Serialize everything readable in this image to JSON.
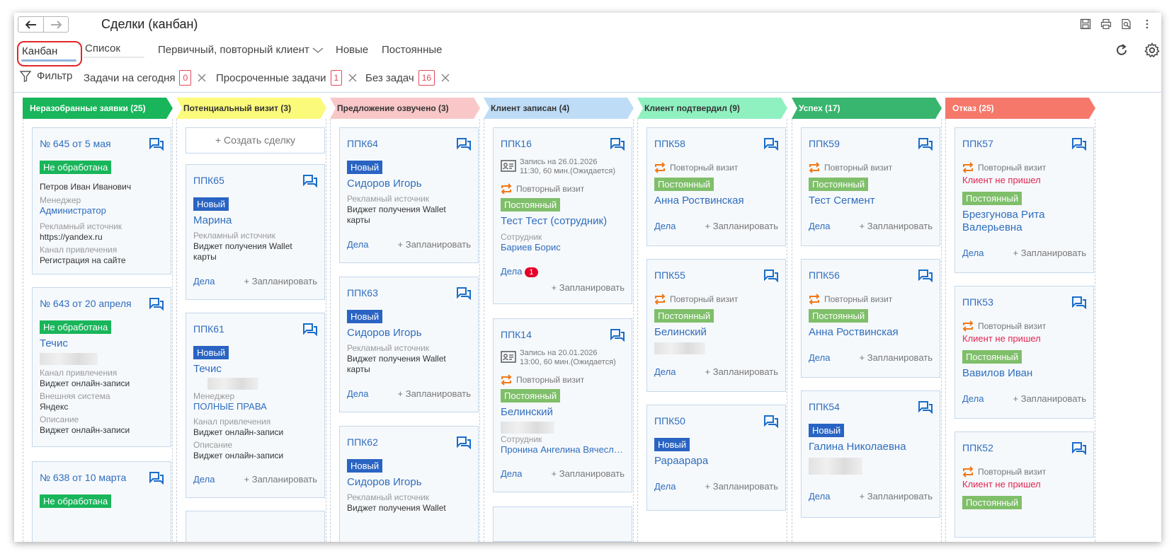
{
  "window": {
    "title": "Сделки (канбан)"
  },
  "tabs": {
    "kanban": "Канбан",
    "list": "Список"
  },
  "filters": {
    "client_type": "Первичный, повторный клиент",
    "new": "Новые",
    "permanent": "Постоянные",
    "filter_label": "Фильтр",
    "today_tasks": "Задачи на сегодня",
    "today_count": "0",
    "overdue": "Просроченные задачи",
    "overdue_count": "1",
    "no_tasks": "Без задач",
    "no_tasks_count": "16"
  },
  "common": {
    "deals": "Дела",
    "plan": "+ Запланировать",
    "create": "+ Создать сделку",
    "repeat": "Повторный визит",
    "no_show": "Клиент не пришел",
    "ad_source": "Рекламный источник",
    "channel": "Канал привлечения",
    "manager": "Менеджер",
    "external": "Внешняя система",
    "description": "Описание",
    "employee": "Сотрудник"
  },
  "columns": [
    {
      "title": "Неразобранные заявки (25)",
      "color": "#18b55a",
      "text_color": "#ffffff"
    },
    {
      "title": "Потенциальный визит (3)",
      "color": "#fbfa7a",
      "text_color": "#333333"
    },
    {
      "title": "Предложение озвучено (3)",
      "color": "#f9c7c8",
      "text_color": "#333333"
    },
    {
      "title": "Клиент записан (4)",
      "color": "#bfdcf7",
      "text_color": "#333333"
    },
    {
      "title": "Клиент подтвердил (9)",
      "color": "#8ff0c0",
      "text_color": "#333333"
    },
    {
      "title": "Успех (17)",
      "color": "#38b56e",
      "text_color": "#ffffff"
    },
    {
      "title": "Отказ (25)",
      "color": "#f5786b",
      "text_color": "#ffffff"
    }
  ],
  "col1": {
    "c1": {
      "num": "№ 645 от 5 мая",
      "badge": "Не обработана",
      "person": "Петров Иван Иванович",
      "manager": "Администратор",
      "source": "https://yandex.ru",
      "channel": "Регистрация на сайте"
    },
    "c2": {
      "num": "№ 643 от 20 апреля",
      "badge": "Не обработана",
      "name": "Течис",
      "channel": "Виджет онлайн-записи",
      "external": "Яндекс",
      "description": "Виджет онлайн-записи"
    },
    "c3": {
      "num": "№ 638 от 10 марта",
      "badge": "Не обработана"
    }
  },
  "col2": {
    "c1": {
      "num": "ППК65",
      "badge": "Новый",
      "name": "Марина",
      "source": "Виджет получения Wallet карты"
    },
    "c2": {
      "num": "ППК61",
      "badge": "Новый",
      "name": "Течис",
      "manager": "ПОЛНЫЕ ПРАВА",
      "channel": "Виджет онлайн-записи",
      "description": "Виджет онлайн-записи"
    }
  },
  "col3": {
    "c1": {
      "num": "ППК64",
      "badge": "Новый",
      "name": "Сидоров Игорь",
      "source": "Виджет получения Wallet карты"
    },
    "c2": {
      "num": "ППК63",
      "badge": "Новый",
      "name": "Сидоров Игорь",
      "source": "Виджет получения Wallet карты"
    },
    "c3": {
      "num": "ППК62",
      "badge": "Новый",
      "name": "Сидоров Игорь",
      "source": "Виджет получения Wallet"
    }
  },
  "col4": {
    "c1": {
      "num": "ППК16",
      "record1": "Запись на 26.01.2026",
      "record2": "11:30, 60 мин.(Ожидается)",
      "badge": "Постоянный",
      "name": "Тест Тест (сотрудник)",
      "employee": "Бариев Борис",
      "deals_count": "1"
    },
    "c2": {
      "num": "ППК14",
      "record1": "Запись на 20.01.2026",
      "record2": "13:00, 60 мин.(Ожидается)",
      "badge": "Постоянный",
      "name": "Белинский",
      "employee": "Пронина Ангелина Вячеславовна"
    }
  },
  "col5": {
    "c1": {
      "num": "ППК58",
      "badge": "Постоянный",
      "name": "Анна Роствинская"
    },
    "c2": {
      "num": "ППК55",
      "badge": "Постоянный",
      "name": "Белинский"
    },
    "c3": {
      "num": "ППК50",
      "badge": "Новый",
      "name": "Рараарара"
    }
  },
  "col6": {
    "c1": {
      "num": "ППК59",
      "badge": "Постоянный",
      "name": "Тест Сегмент"
    },
    "c2": {
      "num": "ППК56",
      "badge": "Постоянный",
      "name": "Анна Роствинская"
    },
    "c3": {
      "num": "ППК54",
      "badge": "Новый",
      "name": "Галина Николаевна"
    }
  },
  "col7": {
    "c1": {
      "num": "ППК57",
      "badge": "Постоянный",
      "name": "Брезгунова Рита Валерьевна"
    },
    "c2": {
      "num": "ППК53",
      "badge": "Постоянный",
      "name": "Вавилов Иван"
    },
    "c3": {
      "num": "ППК52",
      "badge": "Постоянный"
    }
  }
}
